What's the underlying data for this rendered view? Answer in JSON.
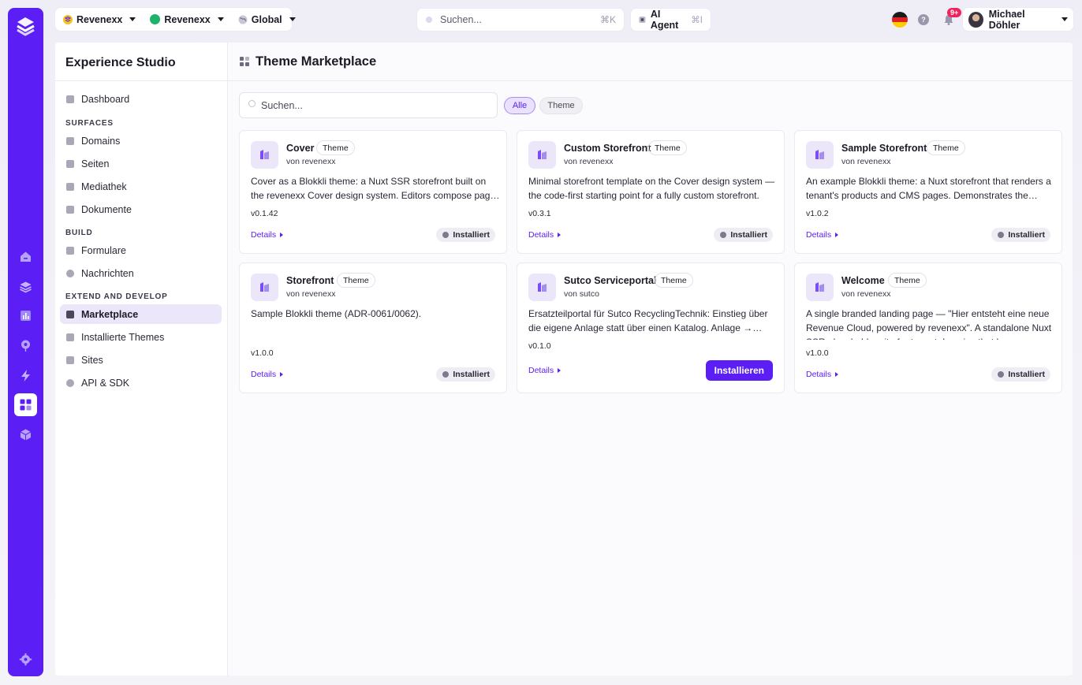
{
  "rail": {
    "icons": [
      "home-icon",
      "layers-icon",
      "analytics-icon",
      "pin-icon",
      "bolt-icon",
      "marketplace-icon",
      "cube-icon",
      "settings-icon"
    ]
  },
  "topbar": {
    "tenant_label": "Revenexx",
    "workspace_label": "Revenexx",
    "region_label": "Global",
    "search_placeholder": "Suchen...",
    "search_shortcut": "⌘K",
    "ai_agent_label": "AI Agent",
    "ai_agent_shortcut": "⌘I",
    "help_label": "?",
    "notification_count": "9+",
    "user_name": "Michael Döhler"
  },
  "sidebar": {
    "title": "Experience Studio",
    "dashboard": "Dashboard",
    "section_surfaces": "SURFACES",
    "domains": "Domains",
    "seiten": "Seiten",
    "mediathek": "Mediathek",
    "dokumente": "Dokumente",
    "section_build": "BUILD",
    "formulare": "Formulare",
    "nachrichten": "Nachrichten",
    "section_extend": "EXTEND AND DEVELOP",
    "marketplace": "Marketplace",
    "installierte_themes": "Installierte Themes",
    "sites": "Sites",
    "api_sdk": "API & SDK"
  },
  "main": {
    "title": "Theme Marketplace",
    "search_placeholder": "Suchen...",
    "filter_all": "Alle",
    "filter_theme": "Theme"
  },
  "cards": [
    {
      "name": "Cover",
      "tag": "Theme",
      "author": "von revenexx",
      "description": "Cover as a Blokkli theme: a Nuxt SSR storefront built on the revenexx Cover design system. Editors compose pages from the available blocks.",
      "version": "v0.1.42",
      "details": "Details",
      "status": "Installiert"
    },
    {
      "name": "Custom Storefront",
      "tag": "Theme",
      "author": "von revenexx",
      "description": "Minimal storefront template on the Cover design system — the code-first starting point for a fully custom storefront.",
      "version": "v0.3.1",
      "details": "Details",
      "status": "Installiert"
    },
    {
      "name": "Sample Storefront",
      "tag": "Theme",
      "author": "von revenexx",
      "description": "An example Blokkli theme: a Nuxt storefront that renders a tenant's products and CMS pages. Demonstrates the theme contract.",
      "version": "v1.0.2",
      "details": "Details",
      "status": "Installiert"
    },
    {
      "name": "Storefront",
      "tag": "Theme",
      "author": "von revenexx",
      "description": "Sample Blokkli theme (ADR-0061/0062).",
      "version": "v1.0.0",
      "details": "Details",
      "status": "Installiert"
    },
    {
      "name": "Sutco Serviceportal",
      "tag": "Theme",
      "author": "von sutco",
      "description": "Ersatzteilportal für Sutco RecyclingTechnik: Einstieg über die eigene Anlage statt über einen Katalog. Anlage → Baugruppe → Ersatzteil.",
      "version": "v0.1.0",
      "details": "Details",
      "action": "Installieren"
    },
    {
      "name": "Welcome",
      "tag": "Theme",
      "author": "von revenexx",
      "description": "A single branded landing page — \"Hier entsteht eine neue Revenue Cloud, powered by revenexx\". A standalone Nuxt SSR placeholder site for tenant domains that have no storefront yet.",
      "version": "v1.0.0",
      "details": "Details",
      "status": "Installiert"
    }
  ],
  "colors": {
    "brand": "#5b1ff5",
    "accent_soft": "#ece6fb",
    "badge": "#f0245d",
    "status_green": "#1fb26b"
  }
}
